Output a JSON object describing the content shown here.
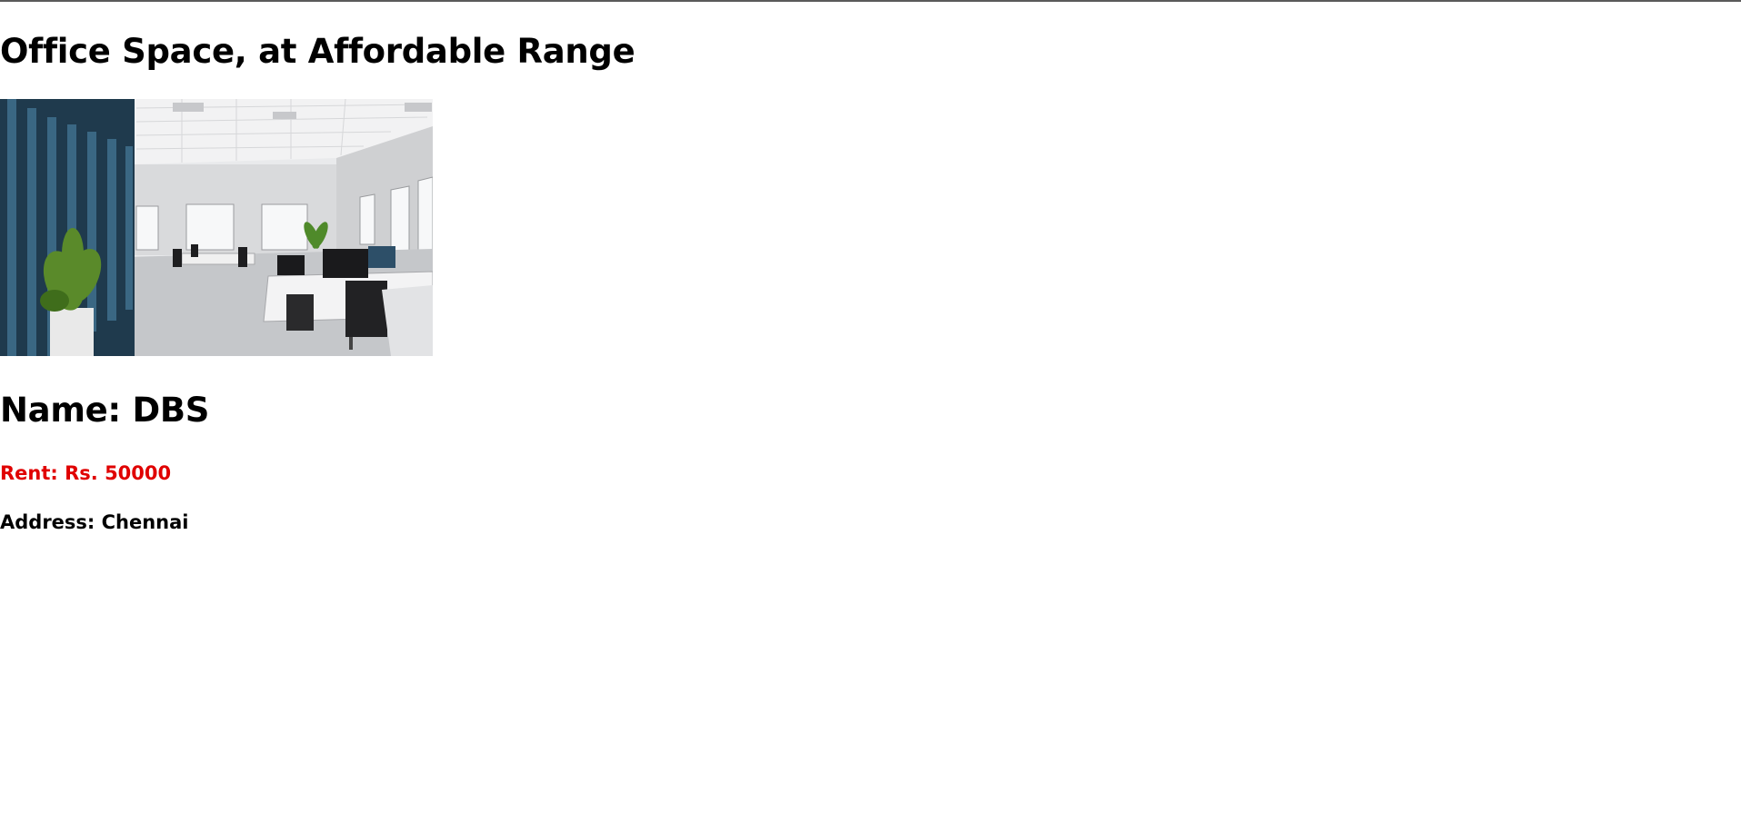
{
  "page": {
    "title": "Office Space, at Affordable Range"
  },
  "listing": {
    "image_alt": "Office interior",
    "name": "Name: DBS",
    "rent": "Rent: Rs. 50000",
    "address": "Address: Chennai"
  },
  "colors": {
    "rent_text": "#e00000",
    "default_text": "#000000",
    "top_rule": "#5a5a5a"
  }
}
